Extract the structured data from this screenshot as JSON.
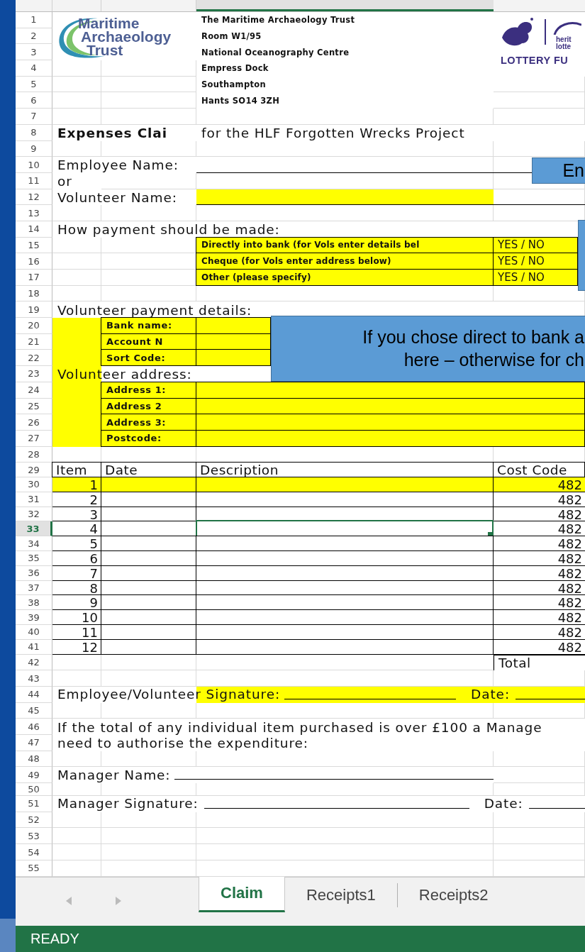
{
  "sheet": {
    "row_headers": [
      {
        "label": "1",
        "selected": false
      },
      {
        "label": "2",
        "selected": false
      },
      {
        "label": "3",
        "selected": false
      },
      {
        "label": "4",
        "selected": false
      },
      {
        "label": "5",
        "selected": false
      },
      {
        "label": "6",
        "selected": false
      },
      {
        "label": "7",
        "selected": false
      },
      {
        "label": "8",
        "selected": false
      },
      {
        "label": "9",
        "selected": false
      },
      {
        "label": "10",
        "selected": false
      },
      {
        "label": "11",
        "selected": false
      },
      {
        "label": "12",
        "selected": false
      },
      {
        "label": "13",
        "selected": false
      },
      {
        "label": "14",
        "selected": false
      },
      {
        "label": "15",
        "selected": false
      },
      {
        "label": "16",
        "selected": false
      },
      {
        "label": "17",
        "selected": false
      },
      {
        "label": "18",
        "selected": false
      },
      {
        "label": "19",
        "selected": false
      },
      {
        "label": "20",
        "selected": false
      },
      {
        "label": "21",
        "selected": false
      },
      {
        "label": "22",
        "selected": false
      },
      {
        "label": "23",
        "selected": false
      },
      {
        "label": "24",
        "selected": false
      },
      {
        "label": "25",
        "selected": false
      },
      {
        "label": "26",
        "selected": false
      },
      {
        "label": "27",
        "selected": false
      },
      {
        "label": "28",
        "selected": false
      },
      {
        "label": "29",
        "selected": false
      },
      {
        "label": "30",
        "selected": false
      },
      {
        "label": "31",
        "selected": false
      },
      {
        "label": "32",
        "selected": false
      },
      {
        "label": "33",
        "selected": true
      },
      {
        "label": "34",
        "selected": false
      },
      {
        "label": "35",
        "selected": false
      },
      {
        "label": "36",
        "selected": false
      },
      {
        "label": "37",
        "selected": false
      },
      {
        "label": "38",
        "selected": false
      },
      {
        "label": "39",
        "selected": false
      },
      {
        "label": "40",
        "selected": false
      },
      {
        "label": "41",
        "selected": false
      },
      {
        "label": "42",
        "selected": false
      },
      {
        "label": "43",
        "selected": false
      },
      {
        "label": "44",
        "selected": false
      },
      {
        "label": "45",
        "selected": false
      },
      {
        "label": "46",
        "selected": false
      },
      {
        "label": "47",
        "selected": false
      },
      {
        "label": "48",
        "selected": false
      },
      {
        "label": "49",
        "selected": false
      },
      {
        "label": "50",
        "selected": false
      },
      {
        "label": "51",
        "selected": false
      },
      {
        "label": "52",
        "selected": false
      },
      {
        "label": "53",
        "selected": false
      },
      {
        "label": "54",
        "selected": false
      },
      {
        "label": "55",
        "selected": false
      }
    ],
    "org_logo": {
      "lines": [
        "Maritime",
        "Archaeology",
        "Trust"
      ]
    },
    "address_lines": [
      "The Maritime Archaeology Trust",
      "Room W1/95",
      "National Oceanography Centre",
      "Empress Dock",
      "Southampton",
      "Hants SO14 3ZH"
    ],
    "funder_logo": {
      "name": "LOTTERY FU",
      "tagline": [
        "herit",
        "lotte"
      ]
    },
    "title": {
      "heading": "Expenses Clai",
      "subtitle": "for the HLF Forgotten Wrecks Project"
    },
    "employee_name": {
      "label": "Employee Name:"
    },
    "or_text": "or",
    "volunteer_name": {
      "label": "Volunteer Name:"
    },
    "payment": {
      "label": "How payment should be made:",
      "options": [
        {
          "text": "Directly into bank (for Vols enter details bel",
          "answer": "YES / NO"
        },
        {
          "text": "Cheque (for Vols enter address below)",
          "answer": "YES / NO"
        },
        {
          "text": "Other (please specify)",
          "answer": "YES / NO"
        }
      ]
    },
    "volunteer_payment": {
      "label": "Volunteer payment details:",
      "fields": [
        "Bank name:",
        "Account N",
        "Sort Code:"
      ]
    },
    "volunteer_address": {
      "label": "Volunteer address:",
      "fields": [
        "Address 1:",
        "Address 2",
        "Address 3:",
        "Postcode:"
      ]
    },
    "items": {
      "columns": [
        "Item",
        "Date",
        "Description",
        "Cost Code"
      ],
      "rows": [
        {
          "item": "1",
          "cost_code": "482",
          "highlighted": true,
          "selected": false
        },
        {
          "item": "2",
          "cost_code": "482",
          "highlighted": false,
          "selected": false
        },
        {
          "item": "3",
          "cost_code": "482",
          "highlighted": false,
          "selected": false
        },
        {
          "item": "4",
          "cost_code": "482",
          "highlighted": false,
          "selected": true
        },
        {
          "item": "5",
          "cost_code": "482",
          "highlighted": false,
          "selected": false
        },
        {
          "item": "6",
          "cost_code": "482",
          "highlighted": false,
          "selected": false
        },
        {
          "item": "7",
          "cost_code": "482",
          "highlighted": false,
          "selected": false
        },
        {
          "item": "8",
          "cost_code": "482",
          "highlighted": false,
          "selected": false
        },
        {
          "item": "9",
          "cost_code": "482",
          "highlighted": false,
          "selected": false
        },
        {
          "item": "10",
          "cost_code": "482",
          "highlighted": false,
          "selected": false
        },
        {
          "item": "11",
          "cost_code": "482",
          "highlighted": false,
          "selected": false
        },
        {
          "item": "12",
          "cost_code": "482",
          "highlighted": false,
          "selected": false
        }
      ],
      "total_label": "Total"
    },
    "claimant_signature": {
      "label": "Employee/Volunteer Signature:",
      "date_label": "Date:"
    },
    "note": [
      "If the total of any individual item purchased is over £100 a Manage",
      "need to authorise the expenditure:"
    ],
    "manager_name": {
      "label": "Manager Name:"
    },
    "manager_signature": {
      "label": "Manager Signature:",
      "date_label": "Date:"
    }
  },
  "callouts": [
    {
      "lines": [
        "En"
      ]
    },
    {
      "lines": [
        "If you chose direct to bank a",
        "here – otherwise for ch"
      ]
    }
  ],
  "sheet_tabs": [
    {
      "label": "Claim",
      "selected": true
    },
    {
      "label": "Receipts1",
      "selected": false
    },
    {
      "label": "Receipts2",
      "selected": false
    }
  ],
  "status_bar": {
    "text": "READY"
  }
}
